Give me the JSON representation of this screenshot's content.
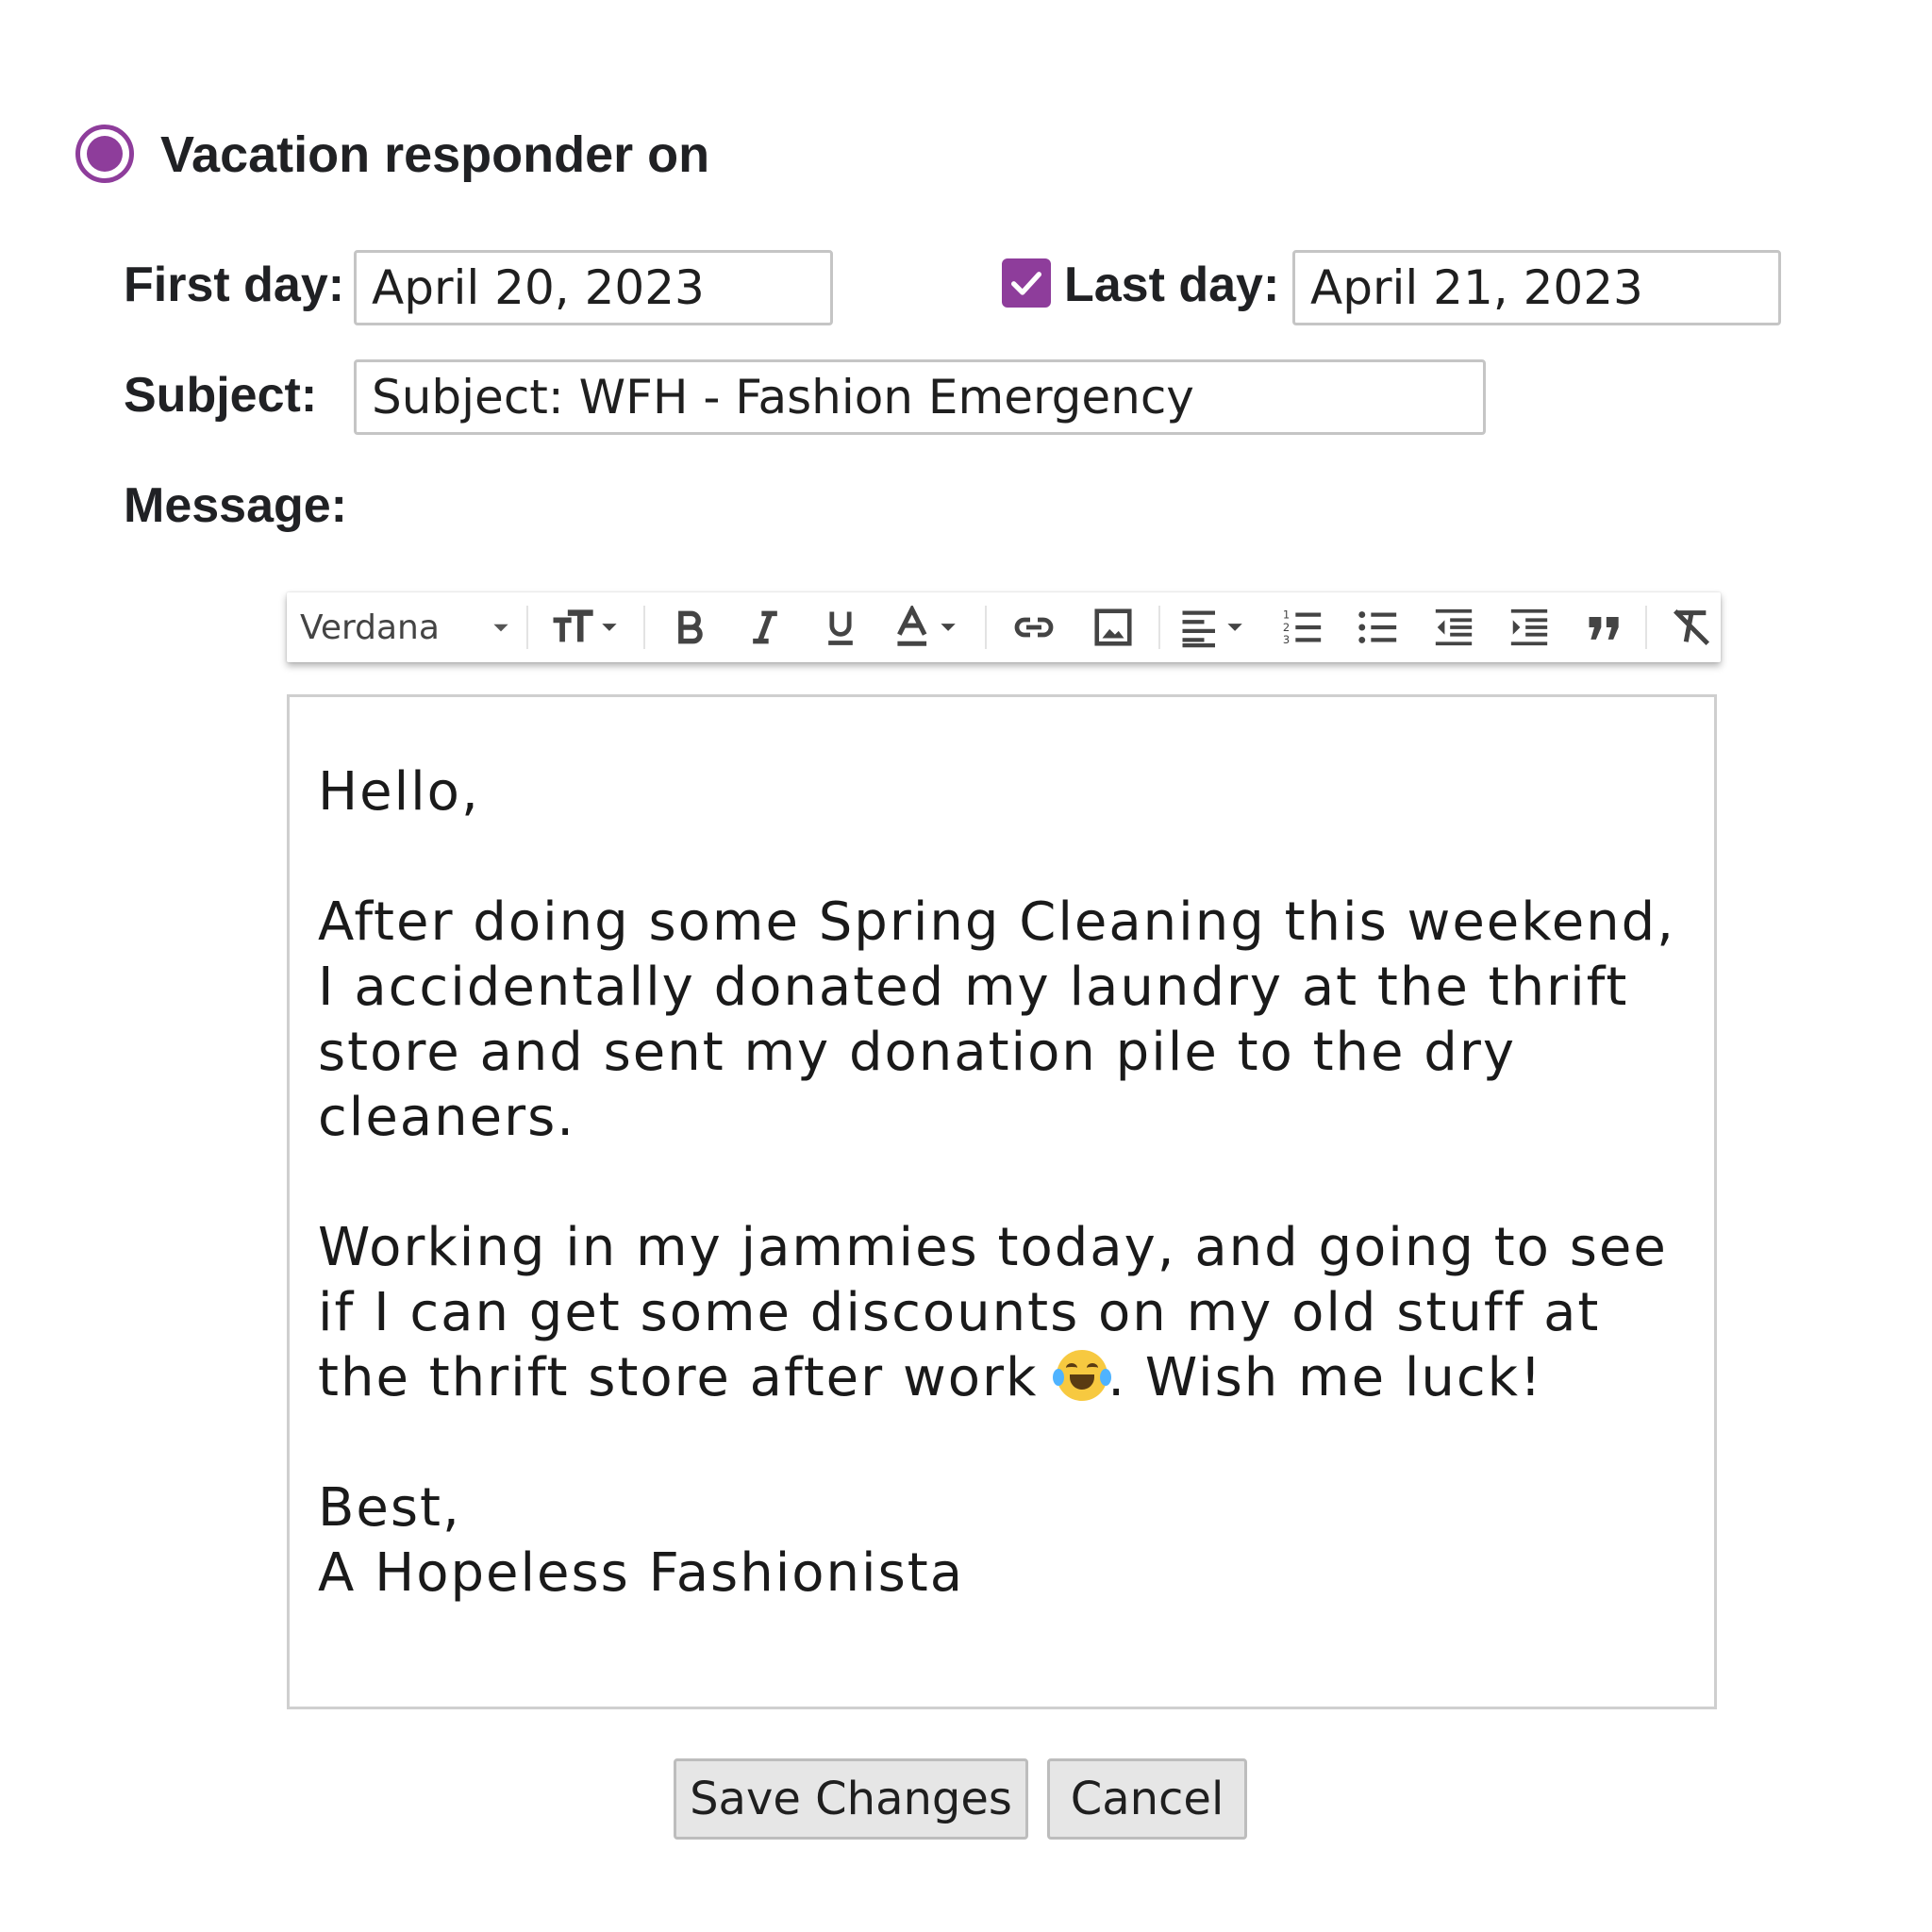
{
  "accent_color": "#8e3d9b",
  "responder": {
    "label": "Vacation responder on",
    "selected": true
  },
  "first_day": {
    "label": "First day:",
    "value": "April 20, 2023"
  },
  "last_day": {
    "label": "Last day:",
    "value": "April 21, 2023",
    "checked": true
  },
  "subject": {
    "label": "Subject:",
    "value": "Subject: WFH - Fashion Emergency"
  },
  "message": {
    "label": "Message:",
    "lines": {
      "greeting": "Hello,",
      "p1": "After doing some Spring Cleaning this weekend, I accidentally donated my laundry at the thrift store and sent my donation pile to the dry cleaners.",
      "p2_before_emoji": "Working in my jammies today, and going to see if I can get some discounts on my old stuff at the thrift store after work ",
      "emoji": "face-with-tears-of-joy",
      "p2_after_emoji": ". Wish me luck!",
      "signoff": "Best,",
      "signature": "A Hopeless Fashionista"
    }
  },
  "toolbar": {
    "font": "Verdana",
    "icons": [
      "font-size-icon",
      "bold-icon",
      "italic-icon",
      "underline-icon",
      "text-color-icon",
      "link-icon",
      "image-icon",
      "align-icon",
      "numbered-list-icon",
      "bulleted-list-icon",
      "indent-less-icon",
      "indent-more-icon",
      "quote-icon",
      "remove-formatting-icon"
    ]
  },
  "buttons": {
    "save": "Save Changes",
    "cancel": "Cancel"
  }
}
